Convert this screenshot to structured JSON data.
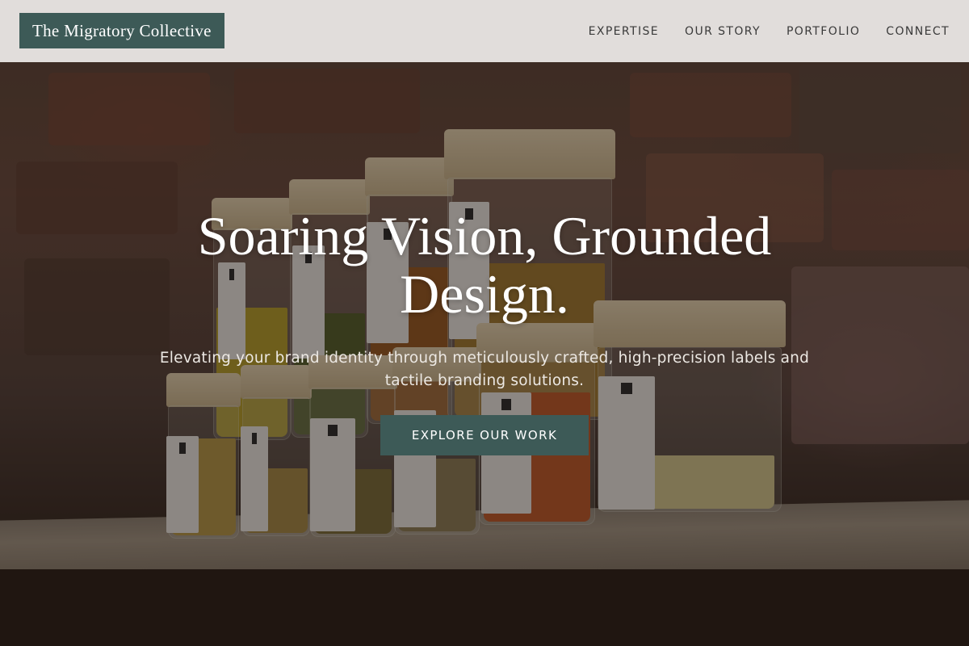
{
  "brand": {
    "name": "The Migratory Collective"
  },
  "nav": {
    "items": [
      {
        "label": "EXPERTISE"
      },
      {
        "label": "OUR STORY"
      },
      {
        "label": "PORTFOLIO"
      },
      {
        "label": "CONNECT"
      }
    ]
  },
  "hero": {
    "headline": "Soaring Vision, Grounded Design.",
    "subheadline": "Elevating your brand identity through meticulously crafted, high-precision labels and tactile branding solutions.",
    "cta_label": "EXPLORE OUR WORK",
    "background_description": ""
  },
  "colors": {
    "accent": "#3d5a57",
    "header_bg": "#ece9e7",
    "nav_text": "#3a3a3a",
    "hero_text": "#ffffff"
  }
}
